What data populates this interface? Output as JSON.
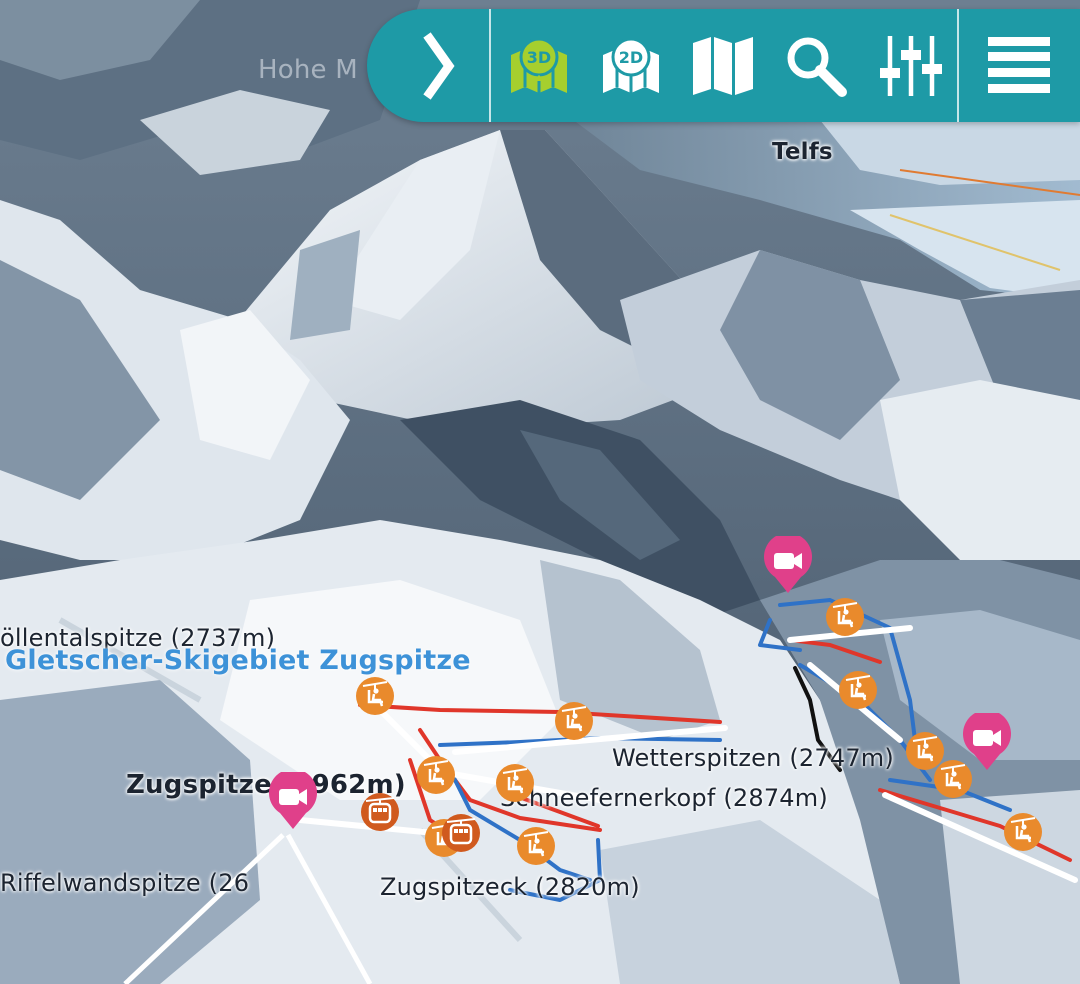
{
  "toolbar": {
    "buttons": [
      {
        "name": "expand-toggle-button",
        "icon": "chevron-right-icon"
      },
      {
        "name": "view-3d-button",
        "icon": "map-3d-icon",
        "text": "3D",
        "active": true,
        "accent": "#a6cf2e"
      },
      {
        "name": "view-2d-button",
        "icon": "map-2d-icon",
        "text": "2D"
      },
      {
        "name": "map-button",
        "icon": "folded-map-icon"
      },
      {
        "name": "search-button",
        "icon": "search-icon"
      },
      {
        "name": "filter-button",
        "icon": "sliders-icon"
      },
      {
        "name": "menu-button",
        "icon": "hamburger-menu-icon"
      }
    ],
    "color": "#1e9aa6"
  },
  "labels": {
    "telfs": "Telfs",
    "hohe": "Hohe M",
    "hoellentalspitze": "öllentalspitze (2737m)",
    "ski_area": "Gletscher-Skigebiet Zugspitze",
    "zugspitze": "Zugspitze (2962m)",
    "wetterspitzen": "Wetterspitzen (2747m)",
    "schneefernerkopf": "Schneefernerkopf (2874m)",
    "zugspitzeck": "Zugspitzeck (2820m)",
    "riffelwandspitze": "Riffelwandspitze (26"
  },
  "markers": {
    "webcams": [
      {
        "name": "webcam-marker-zugspitze",
        "icon": "video-camera-icon"
      },
      {
        "name": "webcam-marker-ehrwald-valley",
        "icon": "video-camera-icon"
      },
      {
        "name": "webcam-marker-ehrwald-slope",
        "icon": "video-camera-icon"
      }
    ],
    "chairlifts": 11,
    "cable_cars": 2
  },
  "colors": {
    "webcam_pin": "#e0408a",
    "lift_icon": "#e98a2c",
    "cable_car_icon": "#d05a1e",
    "piste_red": "#e0362a",
    "piste_blue": "#2f72c7",
    "lift_line": "#ffffff",
    "ski_area_label": "#3d92d8"
  }
}
